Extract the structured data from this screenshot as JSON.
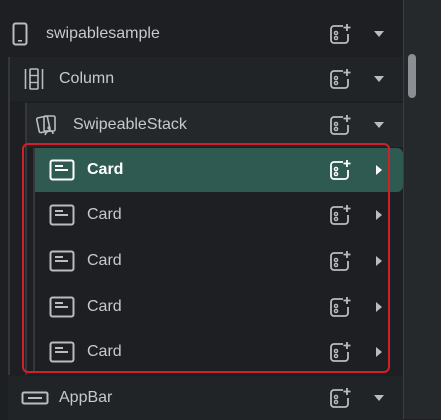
{
  "tree": {
    "root": {
      "label": "swipablesample",
      "icon": "phone-icon"
    },
    "column": {
      "label": "Column",
      "icon": "column-icon"
    },
    "stack": {
      "label": "SwipeableStack",
      "icon": "swipeable-stack-icon"
    },
    "cards": [
      {
        "label": "Card",
        "selected": true
      },
      {
        "label": "Card",
        "selected": false
      },
      {
        "label": "Card",
        "selected": false
      },
      {
        "label": "Card",
        "selected": false
      },
      {
        "label": "Card",
        "selected": false
      }
    ],
    "appbar": {
      "label": "AppBar",
      "icon": "appbar-icon"
    }
  },
  "colors": {
    "selected_row": "#2f5a52",
    "highlight_border": "#d0202a",
    "text": "#c7cacd",
    "icon": "#b9bcc0"
  }
}
